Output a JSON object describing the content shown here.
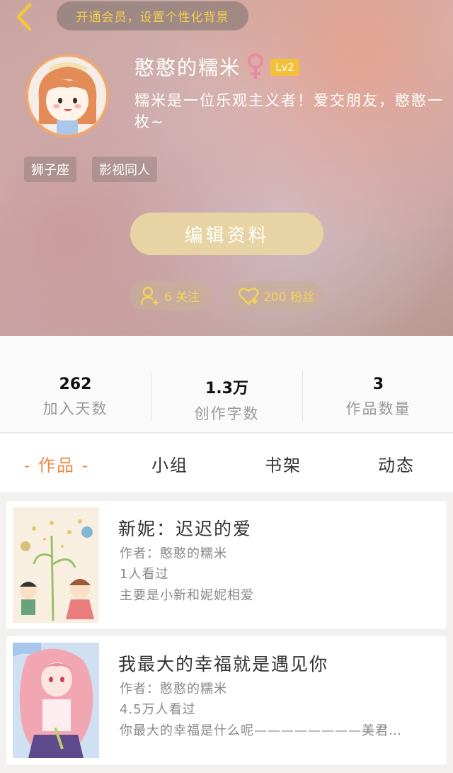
{
  "header": {
    "vip_banner": "开通会员，设置个性化背景",
    "username": "憨憨的糯米",
    "gender_symbol": "♀",
    "level": "Lv2",
    "bio": "糯米是一位乐观主义者！爱交朋友，憨憨一枚~",
    "tags": [
      "狮子座",
      "影视同人"
    ],
    "edit_button": "编辑资料",
    "following": "6 关注",
    "followers": "200 粉丝"
  },
  "stats": [
    {
      "value": "262",
      "label": "加入天数"
    },
    {
      "value": "1.3万",
      "label": "创作字数"
    },
    {
      "value": "3",
      "label": "作品数量"
    }
  ],
  "tabs": [
    "- 作品 -",
    "小组",
    "书架",
    "动态"
  ],
  "works": [
    {
      "title": "新妮：迟迟的爱",
      "author": "作者：憨憨的糯米",
      "views": "1人看过",
      "summary": "主要是小新和妮妮相爱"
    },
    {
      "title": "我最大的幸福就是遇见你",
      "author": "作者：憨憨的糯米",
      "views": "4.5万人看过",
      "summary": "你最大的幸福是什么呢————————美君…"
    }
  ],
  "colors": {
    "accent": "#f08a43",
    "vip_text": "#f4cf4f",
    "level_badge": "#f5c038",
    "edit_button": "#e7d3a4",
    "gender": "#e98aa4"
  },
  "icons": [
    "back-chevron-icon",
    "female-icon",
    "follow-user-icon",
    "heart-icon"
  ]
}
